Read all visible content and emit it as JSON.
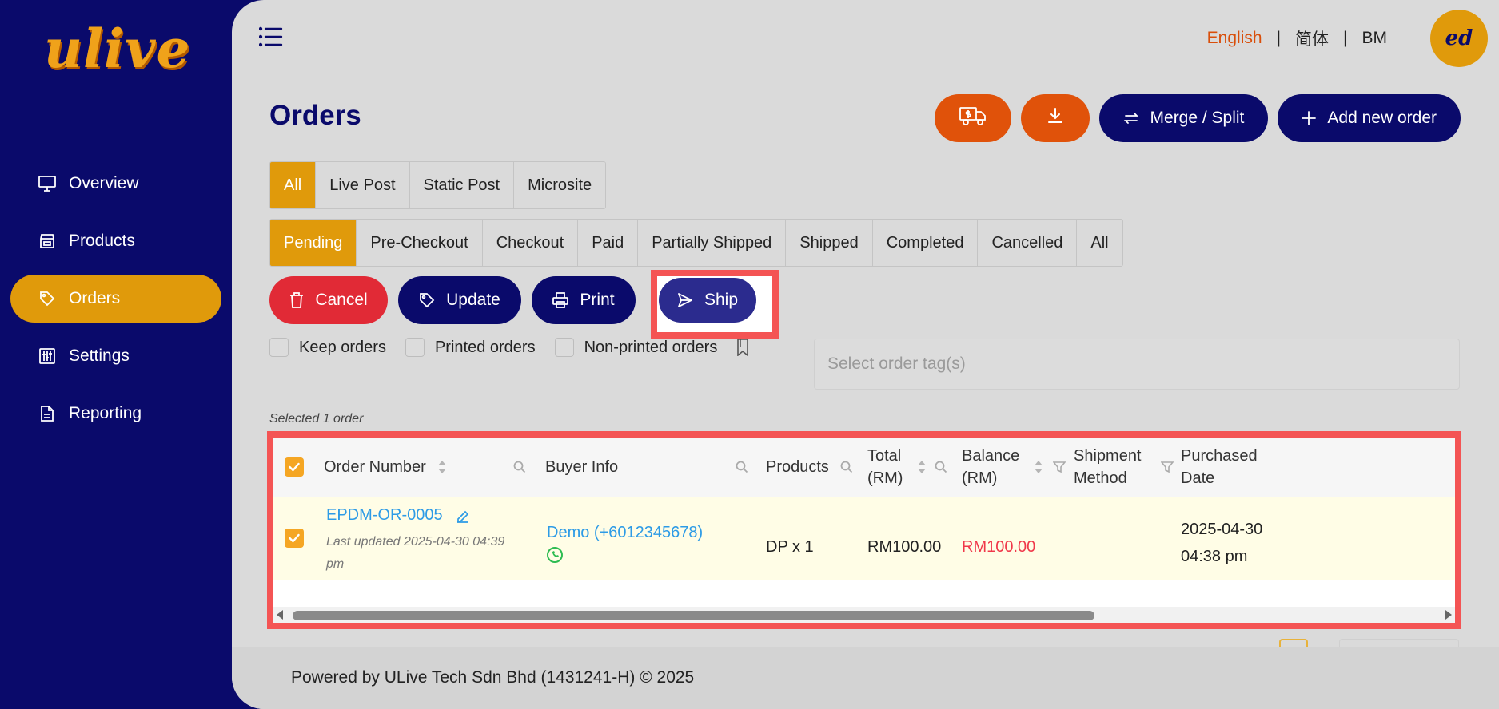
{
  "brand": {
    "logo_text": "ulive",
    "accent": "#e09a0b",
    "navy": "#0a0a6b",
    "orange": "#e0520a",
    "red": "#e12a36"
  },
  "sidebar": {
    "items": [
      {
        "label": "Overview",
        "icon": "monitor-icon"
      },
      {
        "label": "Products",
        "icon": "store-icon"
      },
      {
        "label": "Orders",
        "icon": "tag-icon",
        "active": true
      },
      {
        "label": "Settings",
        "icon": "sliders-icon"
      },
      {
        "label": "Reporting",
        "icon": "document-icon"
      }
    ]
  },
  "header": {
    "languages": [
      "English",
      "简体",
      "BM"
    ],
    "active_language": "English",
    "separator": "|",
    "avatar_initials": "ed"
  },
  "page": {
    "title": "Orders",
    "actions": {
      "shipping_fee_icon": "truck-dollar-icon",
      "download_icon": "download-icon",
      "merge_split_label": "Merge / Split",
      "add_new_order_label": "Add new order"
    }
  },
  "source_tabs": [
    "All",
    "Live Post",
    "Static Post",
    "Microsite"
  ],
  "source_tab_active": "All",
  "status_tabs": [
    "Pending",
    "Pre-Checkout",
    "Checkout",
    "Paid",
    "Partially Shipped",
    "Shipped",
    "Completed",
    "Cancelled",
    "All"
  ],
  "status_tab_active": "Pending",
  "bulk_actions": {
    "cancel_label": "Cancel",
    "update_label": "Update",
    "print_label": "Print",
    "ship_label": "Ship"
  },
  "filters": {
    "keep_orders": "Keep orders",
    "printed_orders": "Printed orders",
    "non_printed_orders": "Non-printed orders",
    "tag_placeholder": "Select order tag(s)"
  },
  "selection_note": "Selected 1 order",
  "table": {
    "columns": {
      "order_number": "Order Number",
      "buyer_info": "Buyer Info",
      "products": "Products",
      "total_1": "Total",
      "total_2": "(RM)",
      "balance_1": "Balance",
      "balance_2": "(RM)",
      "shipment_1": "Shipment",
      "shipment_2": "Method",
      "purchased_1": "Purchased",
      "purchased_2": "Date"
    },
    "rows": [
      {
        "order_number": "EPDM-OR-0005",
        "last_updated_1": "Last updated 2025-04-30 04:39",
        "last_updated_2": "pm",
        "buyer": "Demo (+6012345678)",
        "products": "DP x 1",
        "total": "RM100.00",
        "balance": "RM100.00",
        "shipment_method": "",
        "purchased_1": "2025-04-30",
        "purchased_2": "04:38 pm",
        "selected": true
      }
    ]
  },
  "footer": {
    "text": "Powered by ULive Tech Sdn Bhd (1431241-H) © 2025"
  }
}
